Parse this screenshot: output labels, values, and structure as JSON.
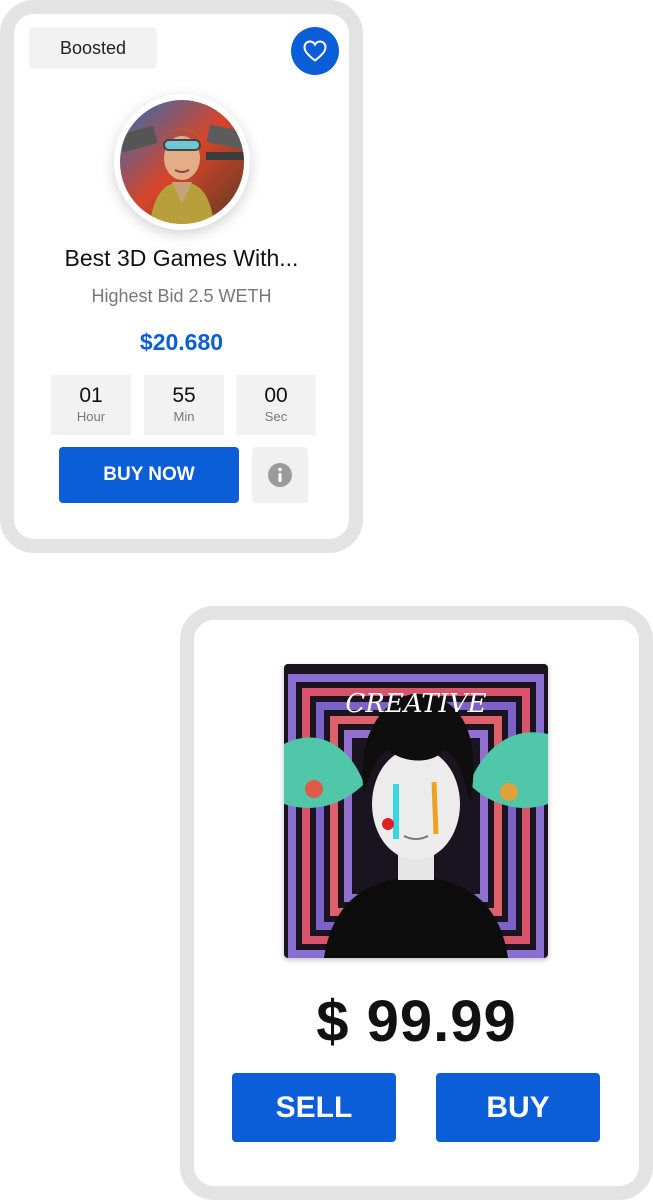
{
  "card1": {
    "badge": "Boosted",
    "title": "Best 3D Games With...",
    "subtitle": "Highest Bid 2.5 WETH",
    "price": "$20.680",
    "timer": [
      {
        "value": "01",
        "label": "Hour"
      },
      {
        "value": "55",
        "label": "Min"
      },
      {
        "value": "00",
        "label": "Sec"
      }
    ],
    "buy_label": "BUY NOW",
    "icons": {
      "favorite": "heart-icon",
      "info": "info-icon"
    }
  },
  "card2": {
    "art_text": "CREATIVE",
    "price": "$ 99.99",
    "sell_label": "SELL",
    "buy_label": "BUY"
  },
  "colors": {
    "accent": "#0b5ed7",
    "frame": "#e3e3e3",
    "muted": "#f2f2f2"
  }
}
